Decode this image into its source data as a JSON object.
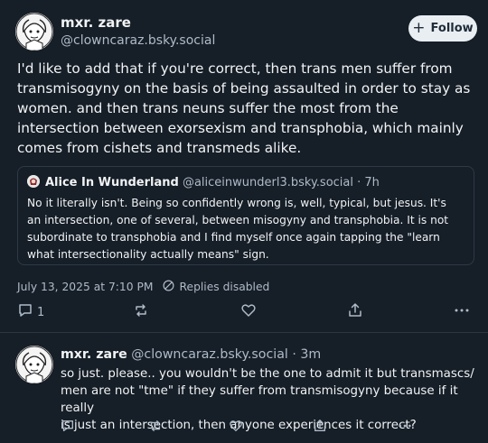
{
  "post": {
    "author_name": "mxr. zare",
    "author_handle": "@clowncaraz.bsky.social",
    "follow_label": "Follow",
    "text": "I'd like to add that if you're correct, then trans men suffer from\ntransmisogyny on the basis of being assaulted in order to stay as\nwomen. and then trans neuns suffer the most from the\nintersection between exorsexism and transphobia, which mainly\ncomes from cishets and transmeds alike.",
    "quote": {
      "author_name": "Alice In Wunderland",
      "author_handle": "@aliceinwunderl3.bsky.social",
      "time": "· 7h",
      "text": "No it literally isn't. Being so confidently wrong is, well, typical, but jesus. It's\nan intersection, one of several, between misogyny and transphobia. It is not\nsubordinate to transphobia and I find myself once again tapping the \"learn\nwhat intersectionality actually means\" sign."
    },
    "timestamp": "July 13, 2025 at 7:10 PM",
    "replies_status": "Replies disabled",
    "reply_count": "1"
  },
  "reply": {
    "author_name": "mxr. zare",
    "author_handle": "@clowncaraz.bsky.social",
    "time": "· 3m",
    "text": "so just. please.. you wouldn't be the one to admit it but transmascs/\nmen are not \"tme\" if they suffer from transmisogyny because if it really\nis just an intersection, then anyone experiences it correct?"
  },
  "icons": [
    "avatar",
    "plus-icon",
    "reply-icon",
    "repost-icon",
    "like-icon",
    "share-icon",
    "more-icon",
    "replies-disabled-icon"
  ],
  "colors": {
    "background": "#161e27",
    "text": "#f1f3f5",
    "muted": "#aebbc9",
    "border": "#2e3a47",
    "follow_bg": "#e9eef3"
  }
}
